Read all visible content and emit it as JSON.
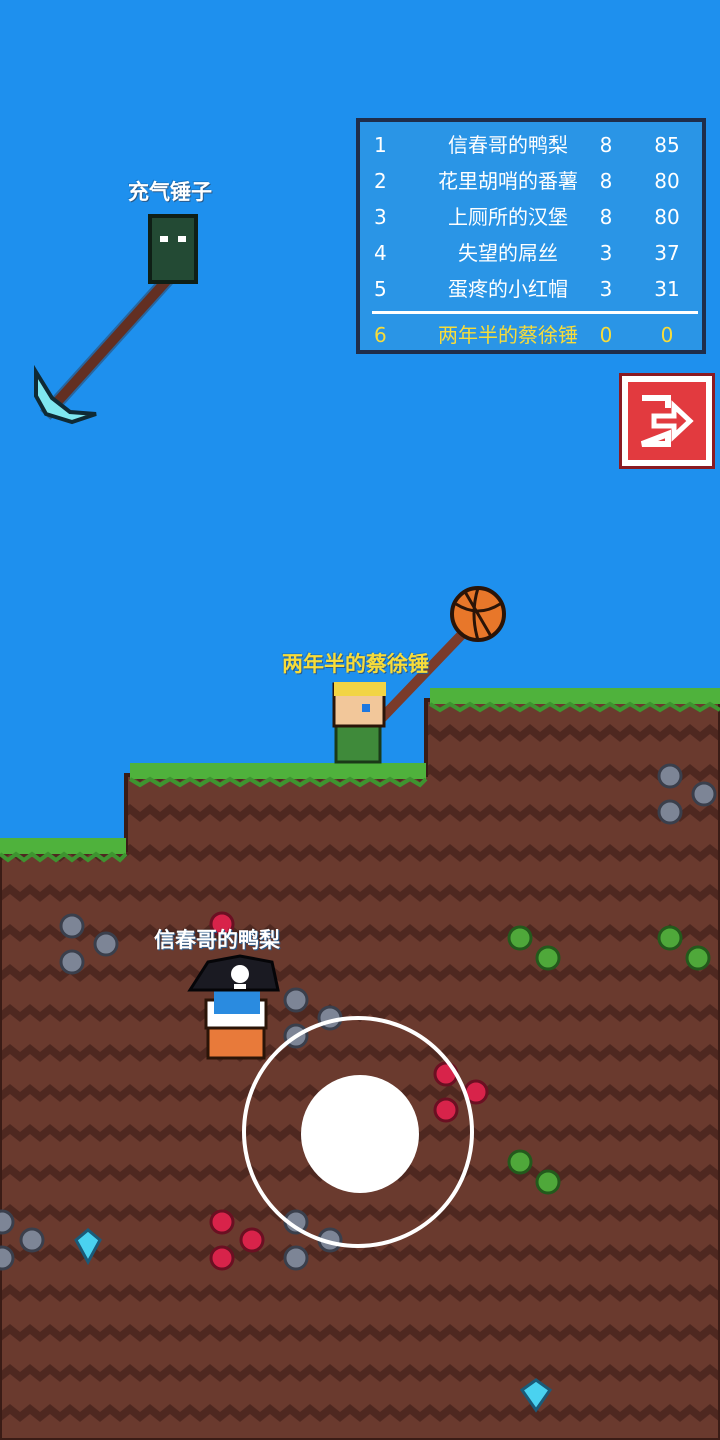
{
  "colors": {
    "sky": "#1e90ee",
    "grass": "#4fb23c",
    "dirt": "#6a3a2e",
    "dirt_wave": "#4e2820",
    "self_name": "#f7dc3a",
    "exit_red": "#e23a3f"
  },
  "floating_item": {
    "label": "充气锤子",
    "icon": "pickaxe-hammer-icon"
  },
  "players": [
    {
      "name": "两年半的蔡徐锤",
      "is_self": true,
      "weapon_icon": "basketball-hammer-icon"
    },
    {
      "name": "信春哥的鸭梨",
      "is_self": false,
      "avatar_icon": "pirate-skull-hat-icon"
    }
  ],
  "leaderboard": {
    "rows": [
      {
        "rank": "1",
        "name": "信春哥的鸭梨",
        "level": "8",
        "score": "85"
      },
      {
        "rank": "2",
        "name": "花里胡哨的番薯",
        "level": "8",
        "score": "80"
      },
      {
        "rank": "3",
        "name": "上厕所的汉堡",
        "level": "8",
        "score": "80"
      },
      {
        "rank": "4",
        "name": "失望的屌丝",
        "level": "3",
        "score": "37"
      },
      {
        "rank": "5",
        "name": "蛋疼的小红帽",
        "level": "3",
        "score": "31"
      }
    ],
    "self_row": {
      "rank": "6",
      "name": "两年半的蔡徐锤",
      "level": "0",
      "score": "0"
    }
  },
  "controls": {
    "exit_icon": "exit-door-arrow-icon",
    "joystick": "virtual-joystick"
  },
  "ores": [
    "iron-ore-icon",
    "emerald-ore-icon",
    "ruby-ore-icon",
    "diamond-ore-icon"
  ]
}
